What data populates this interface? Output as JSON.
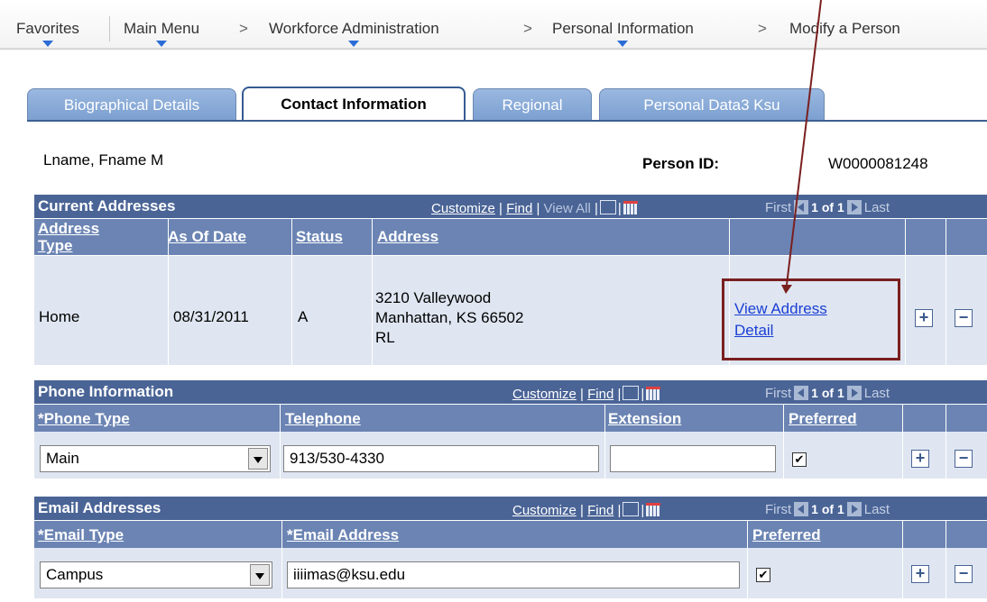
{
  "nav": {
    "favorites": "Favorites",
    "main_menu": "Main Menu",
    "workforce_admin": "Workforce Administration",
    "personal_info": "Personal Information",
    "modify_person": "Modify a Person",
    "sep": ">"
  },
  "tabs": [
    {
      "label": "Biographical Details",
      "active": false
    },
    {
      "label": "Contact Information",
      "active": true
    },
    {
      "label": "Regional",
      "active": false
    },
    {
      "label": "Personal Data3 Ksu",
      "active": false
    }
  ],
  "person": {
    "name": "Lname, Fname M",
    "id_label": "Person ID:",
    "id_value": "W0000081248"
  },
  "grid_tools": {
    "customize": "Customize",
    "find": "Find",
    "view_all": "View All",
    "first": "First",
    "page": "1 of 1",
    "last": "Last",
    "bar": "|"
  },
  "addresses": {
    "title": "Current Addresses",
    "col_type": "Address Type",
    "col_type_1": "Address",
    "col_type_2": "Type",
    "col_date": "As Of Date",
    "col_status": "Status",
    "col_address": "Address",
    "row": {
      "type": "Home",
      "date": "08/31/2011",
      "status": "A",
      "line1": "3210 Valleywood",
      "line2": "Manhattan, KS 66502",
      "line3": "RL",
      "detail_1": "View Address",
      "detail_2": "Detail"
    }
  },
  "phones": {
    "title": "Phone Information",
    "col_type": "*Phone Type",
    "col_phone": "Telephone",
    "col_ext": "Extension",
    "col_pref": "Preferred",
    "row": {
      "type": "Main",
      "phone": "913/530-4330",
      "ext": "",
      "preferred": true
    }
  },
  "emails": {
    "title": "Email Addresses",
    "col_type": "*Email Type",
    "col_email": "*Email Address",
    "col_pref": "Preferred",
    "row": {
      "type": "Campus",
      "email": "iiiimas@ksu.edu",
      "preferred": true
    }
  },
  "buttons": {
    "add": "+",
    "remove": "−",
    "check": "✔"
  },
  "colors": {
    "header": "#4a6496",
    "column_header": "#6b84b3",
    "row": "#dfe6f1",
    "highlight": "#7a1f1f",
    "link": "#1a3fd4"
  }
}
